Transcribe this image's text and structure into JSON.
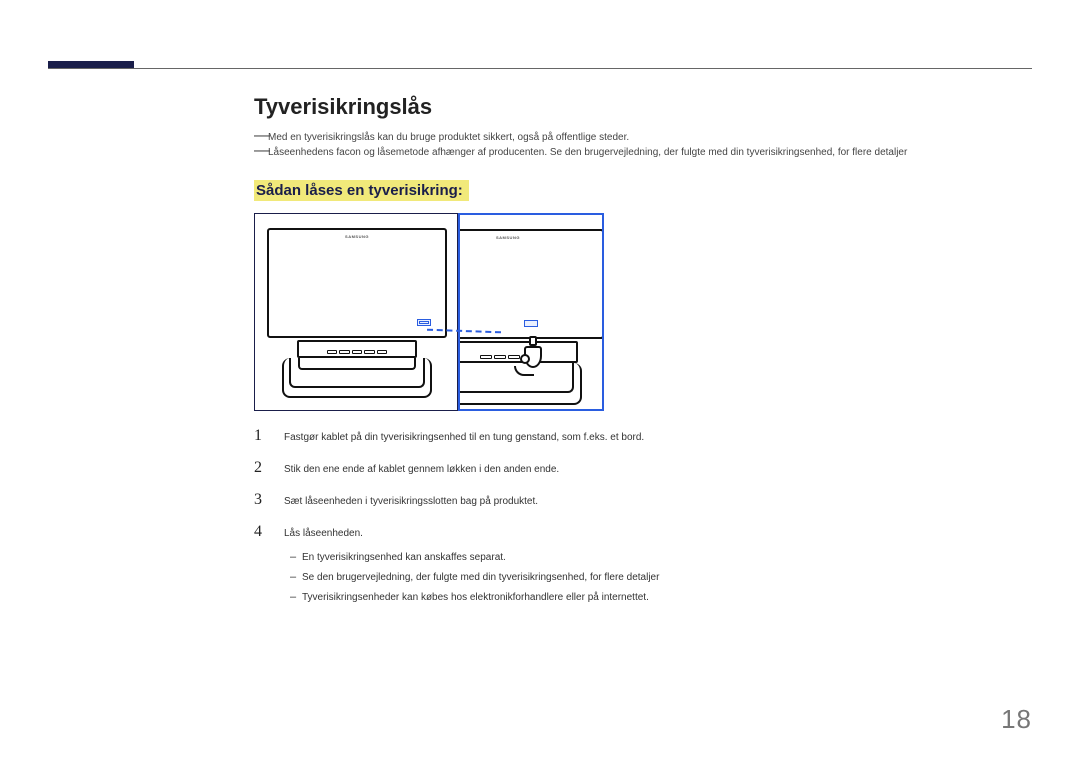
{
  "title": "Tyverisikringslås",
  "notes": [
    "Med en tyverisikringslås kan du bruge produktet sikkert, også på offentlige steder.",
    "Låseenhedens facon og låsemetode afhænger af producenten. Se den brugervejledning, der fulgte med din tyverisikringsenhed, for flere detaljer"
  ],
  "subheading": "Sådan låses en tyverisikring:",
  "brand": "SAMSUNG",
  "steps": [
    {
      "n": "1",
      "text": "Fastgør kablet på din tyverisikringsenhed til en tung genstand, som f.eks. et bord."
    },
    {
      "n": "2",
      "text": "Stik den ene ende af kablet gennem løkken i den anden ende."
    },
    {
      "n": "3",
      "text": "Sæt låseenheden i tyverisikringsslotten bag på produktet."
    },
    {
      "n": "4",
      "text": "Lås låseenheden."
    }
  ],
  "substeps": [
    "En tyverisikringsenhed kan anskaffes separat.",
    "Se den brugervejledning, der fulgte med din tyverisikringsenhed, for flere detaljer",
    "Tyverisikringsenheder kan købes hos elektronikforhandlere eller på internettet."
  ],
  "page_number": "18"
}
